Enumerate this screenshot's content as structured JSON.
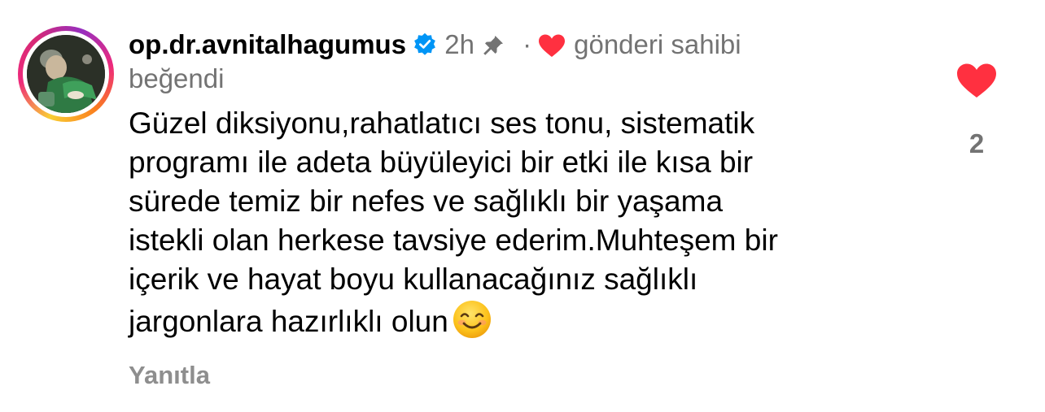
{
  "comment": {
    "username": "op.dr.avnitalhagumus",
    "time": "2h",
    "separator": "·",
    "owner_label": "gönderi sahibi",
    "liked_label": "beğendi",
    "text": "Güzel diksiyonu,rahatlatıcı ses tonu, sistematik\nprogramı ile adeta büyüleyici bir etki ile kısa bir\nsürede temiz bir nefes ve sağlıklı bir yaşama\nistekli olan herkese tavsiye ederim.Muhteşem bir\niçerik ve hayat boyu kullanacağınız sağlıklı\njargonlara hazırlıklı olun",
    "reply_label": "Yanıtla",
    "like_count": "2"
  },
  "icons": {
    "verified": "verified-badge-icon",
    "pin": "pin-icon",
    "owner_heart": "heart-icon",
    "emoji": "smiling-face-emoji",
    "like": "heart-icon"
  },
  "colors": {
    "heart": "#ff3040",
    "verified": "#0095f6",
    "secondary_text": "#737373"
  }
}
